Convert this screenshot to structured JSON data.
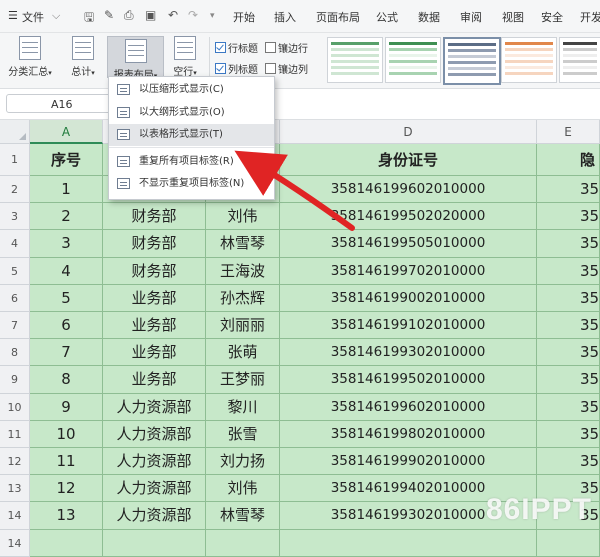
{
  "menubar": {
    "file": "文件",
    "tabs": [
      "开始",
      "插入",
      "页面布局",
      "公式",
      "数据",
      "审阅",
      "视图",
      "安全",
      "开发"
    ]
  },
  "ribbon": {
    "buttons": [
      "分类汇总",
      "总计",
      "报表布局",
      "空行"
    ],
    "checkboxes": [
      {
        "label": "行标题",
        "checked": true
      },
      {
        "label": "镶边行",
        "checked": false
      },
      {
        "label": "列标题",
        "checked": true
      },
      {
        "label": "镶边列",
        "checked": false
      }
    ]
  },
  "namebox": {
    "value": "A16"
  },
  "dropdown": {
    "items": [
      "以压缩形式显示(C)",
      "以大纲形式显示(O)",
      "以表格形式显示(T)",
      "重复所有项目标签(R)",
      "不显示重复项目标签(N)"
    ],
    "highlighted_index": 2
  },
  "sheet": {
    "columns": [
      "A",
      "B",
      "C",
      "D",
      "E"
    ],
    "row_numbers": [
      "1",
      "2",
      "3",
      "4",
      "5",
      "6",
      "7",
      "8",
      "9",
      "10",
      "11",
      "12",
      "13",
      "14"
    ],
    "header": [
      "序号",
      "",
      "",
      "身份证号",
      "隐"
    ],
    "rows": [
      [
        "1",
        "",
        "",
        "358146199602010000",
        "35"
      ],
      [
        "2",
        "财务部",
        "刘伟",
        "358146199502020000",
        "35"
      ],
      [
        "3",
        "财务部",
        "林雪琴",
        "358146199505010000",
        "35"
      ],
      [
        "4",
        "财务部",
        "王海波",
        "358146199702010000",
        "35"
      ],
      [
        "5",
        "业务部",
        "孙杰辉",
        "358146199002010000",
        "35"
      ],
      [
        "6",
        "业务部",
        "刘丽丽",
        "358146199102010000",
        "35"
      ],
      [
        "7",
        "业务部",
        "张萌",
        "358146199302010000",
        "35"
      ],
      [
        "8",
        "业务部",
        "王梦丽",
        "358146199502010000",
        "35"
      ],
      [
        "9",
        "人力资源部",
        "黎川",
        "358146199602010000",
        "35"
      ],
      [
        "10",
        "人力资源部",
        "张雪",
        "358146199802010000",
        "35"
      ],
      [
        "11",
        "人力资源部",
        "刘力扬",
        "358146199902010000",
        "35"
      ],
      [
        "12",
        "人力资源部",
        "刘伟",
        "358146199402010000",
        "35"
      ],
      [
        "13",
        "人力资源部",
        "林雪琴",
        "358146199302010000",
        "35"
      ]
    ]
  },
  "watermark": "86IPPT",
  "colors": {
    "cell_green": "#c7e8c9",
    "selected_header": "#d3e6d4",
    "arrow": "#e02424"
  }
}
